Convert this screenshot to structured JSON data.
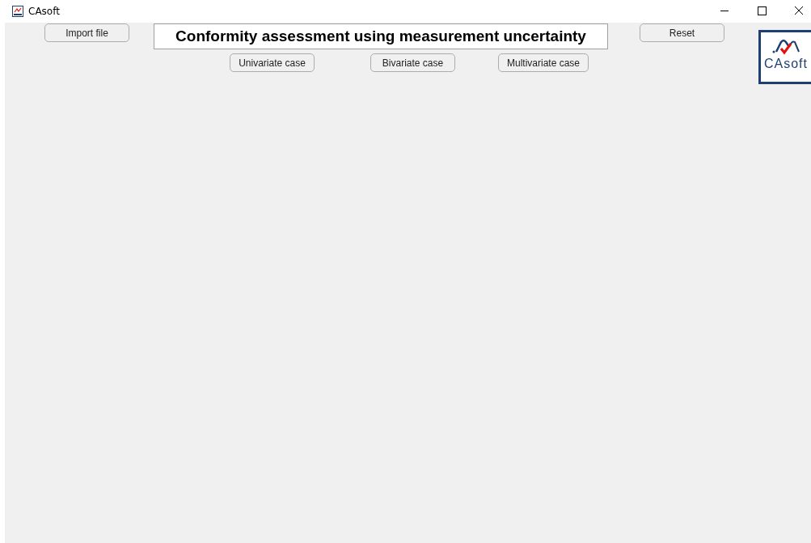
{
  "window": {
    "title": "CAsoft"
  },
  "toolbar": {
    "import_button": "Import file",
    "heading": "Conformity assessment using measurement uncertainty",
    "reset_button": "Reset"
  },
  "case_buttons": [
    {
      "label": "Univariate case"
    },
    {
      "label": "Bivariate case"
    },
    {
      "label": "Multivariate case"
    }
  ],
  "logo": {
    "text": "CAsoft"
  }
}
